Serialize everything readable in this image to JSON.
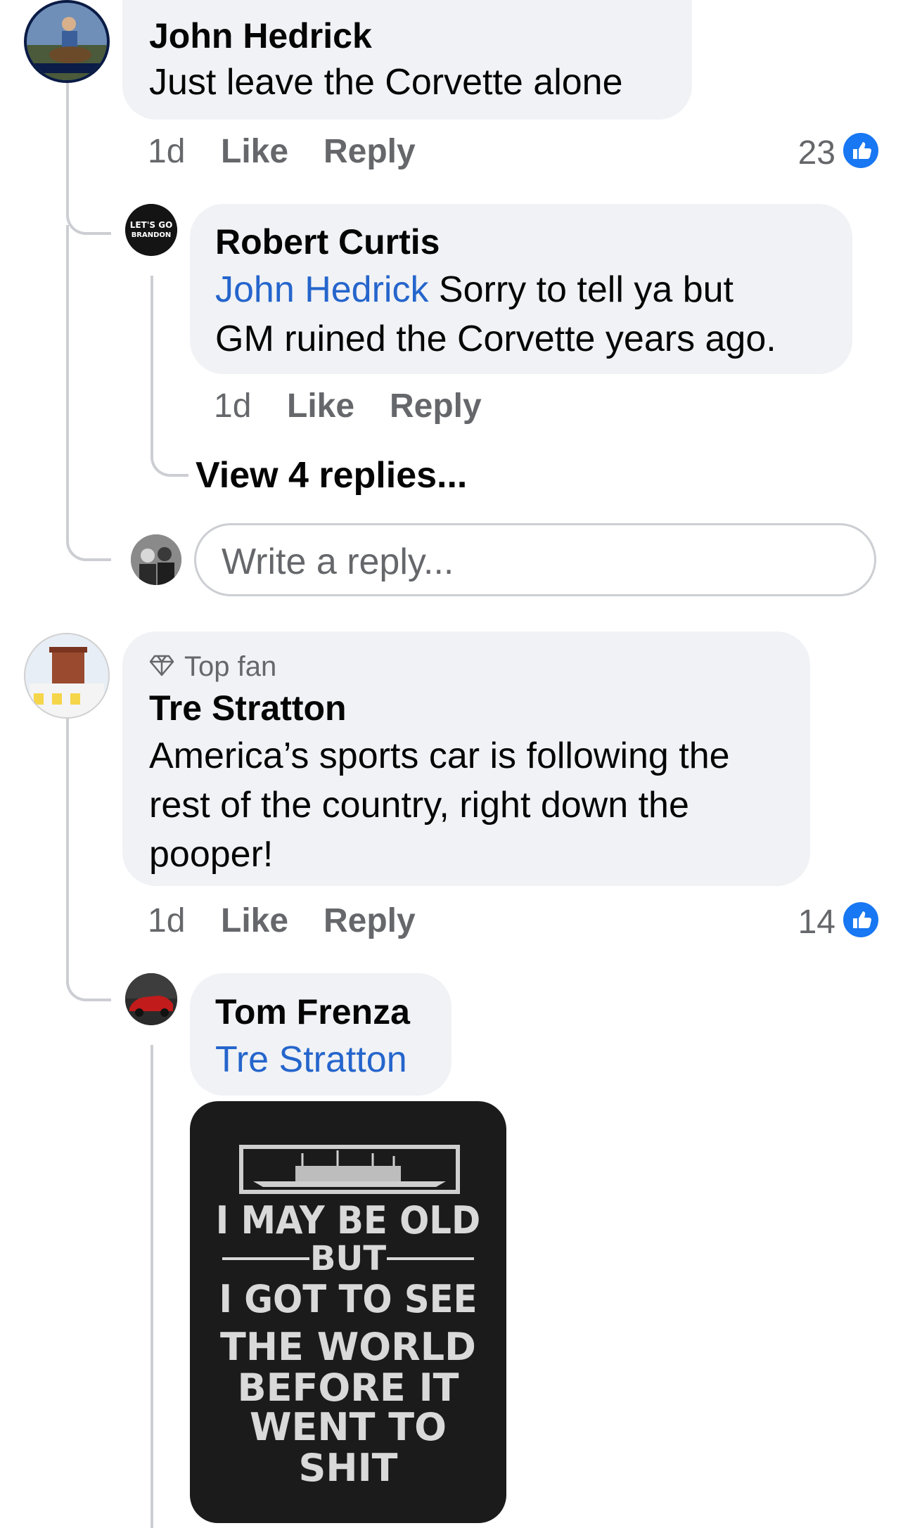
{
  "colors": {
    "bubble": "#f0f2f5",
    "mention": "#2565cc",
    "meta": "#65676b",
    "like_icon": "#1877f2",
    "thread_line": "#ccced3"
  },
  "comments": {
    "c1": {
      "author": "John Hedrick",
      "text": "Just leave the Corvette alone",
      "time": "1d",
      "like_label": "Like",
      "reply_label": "Reply",
      "like_count": "23",
      "avatar_icon": "avatar-icon"
    },
    "c1_reply": {
      "author": "Robert Curtis",
      "mention": "John Hedrick",
      "text_line1": " Sorry to tell ya but",
      "text_line2": "GM ruined the Corvette years ago.",
      "time": "1d",
      "like_label": "Like",
      "reply_label": "Reply",
      "avatar_text_1": "LET'S GO",
      "avatar_text_2": "BRANDON"
    },
    "view_replies": "View 4 replies...",
    "write_reply_placeholder": "Write a reply...",
    "c2": {
      "badge": "Top fan",
      "author": "Tre Stratton",
      "text_line1": "America’s sports car is following the",
      "text_line2": "rest of the country, right down the",
      "text_line3": "pooper!",
      "time": "1d",
      "like_label": "Like",
      "reply_label": "Reply",
      "like_count": "14"
    },
    "c2_reply": {
      "author": "Tom Frenza",
      "mention": "Tre Stratton",
      "image_text": [
        "I MAY BE OLD",
        "BUT",
        "I GOT TO SEE",
        "THE WORLD",
        "BEFORE IT",
        "WENT TO",
        "SHIT"
      ]
    }
  }
}
